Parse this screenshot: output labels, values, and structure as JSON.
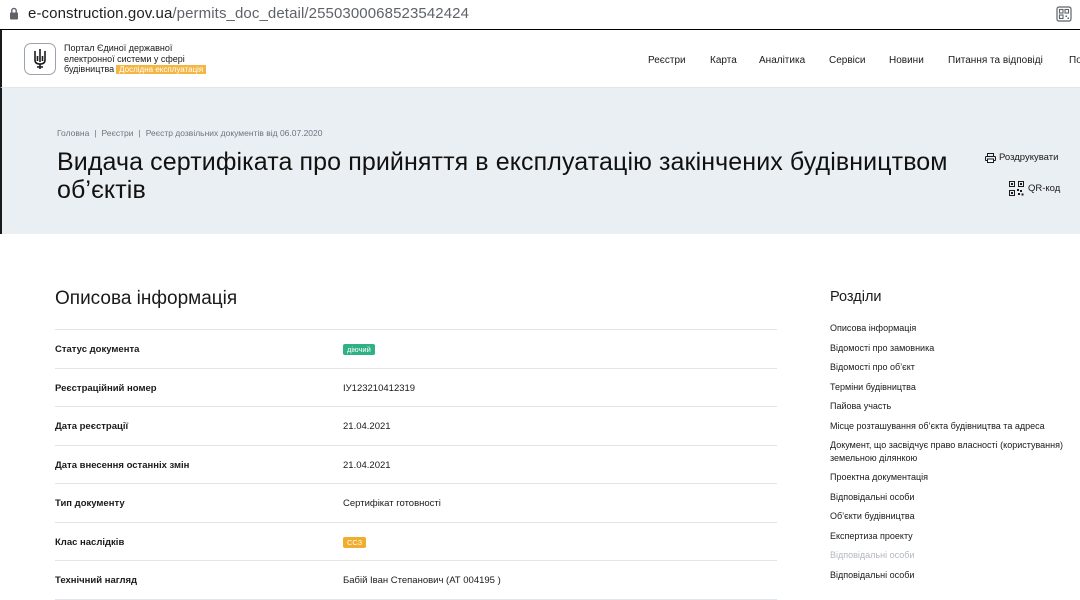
{
  "browser": {
    "url_host": "e-construction.gov.ua",
    "url_path": "/permits_doc_detail/2550300068523542424"
  },
  "header": {
    "portal_line1": "Портал Єдиної державної",
    "portal_line2": "електронної системи у сфері",
    "portal_line3": "будівництва",
    "badge": "Дослідна експлуатація",
    "nav": [
      "Реєстри",
      "Карта",
      "Аналітика",
      "Сервіси",
      "Новини",
      "Питання та відповіді",
      "По"
    ]
  },
  "breadcrumb": [
    "Головна",
    "Реєстри",
    "Реєстр дозвільних документів від 06.07.2020"
  ],
  "page_title": "Видача сертифіката про прийняття в експлуатацію закінчених будівництвом об’єктів",
  "actions": {
    "print": "Роздрукувати",
    "qr": "QR-код"
  },
  "main": {
    "section_title": "Описова інформація",
    "rows": [
      {
        "label": "Статус документа",
        "value": "діючий",
        "type": "pill",
        "color": "#2fb085"
      },
      {
        "label": "Реєстраційний номер",
        "value": "ІУ123210412319",
        "type": "text"
      },
      {
        "label": "Дата реєстрації",
        "value": "21.04.2021",
        "type": "text"
      },
      {
        "label": "Дата внесення останніх змін",
        "value": "21.04.2021",
        "type": "text"
      },
      {
        "label": "Тип документу",
        "value": "Сертифікат готовності",
        "type": "text"
      },
      {
        "label": "Клас наслідків",
        "value": "СС3",
        "type": "pill",
        "color": "#f0ad2e"
      },
      {
        "label": "Технічний нагляд",
        "value": "Бабій Іван Степанович (АТ 004195 )",
        "type": "text"
      }
    ]
  },
  "sections": {
    "title": "Розділи",
    "items": [
      {
        "label": "Описова інформація",
        "muted": false
      },
      {
        "label": "Відомості про замовника",
        "muted": false
      },
      {
        "label": "Відомості про об’єкт",
        "muted": false
      },
      {
        "label": "Терміни будівництва",
        "muted": false
      },
      {
        "label": "Пайова участь",
        "muted": false
      },
      {
        "label": "Місце розташування об’єкта будівництва та адреса",
        "muted": false
      },
      {
        "label": "Документ, що засвідчує право власності (користування) земельною ділянкою",
        "muted": false
      },
      {
        "label": "Проектна документація",
        "muted": false
      },
      {
        "label": "Відповідальні особи",
        "muted": false
      },
      {
        "label": "Об’єкти будівництва",
        "muted": false
      },
      {
        "label": "Експертиза проекту",
        "muted": false
      },
      {
        "label": "Відповідальні особи",
        "muted": true
      },
      {
        "label": "Відповідальні особи",
        "muted": false
      }
    ]
  },
  "colors": {
    "hero_bg": "#eaeff3",
    "badge": "#f4b642"
  }
}
